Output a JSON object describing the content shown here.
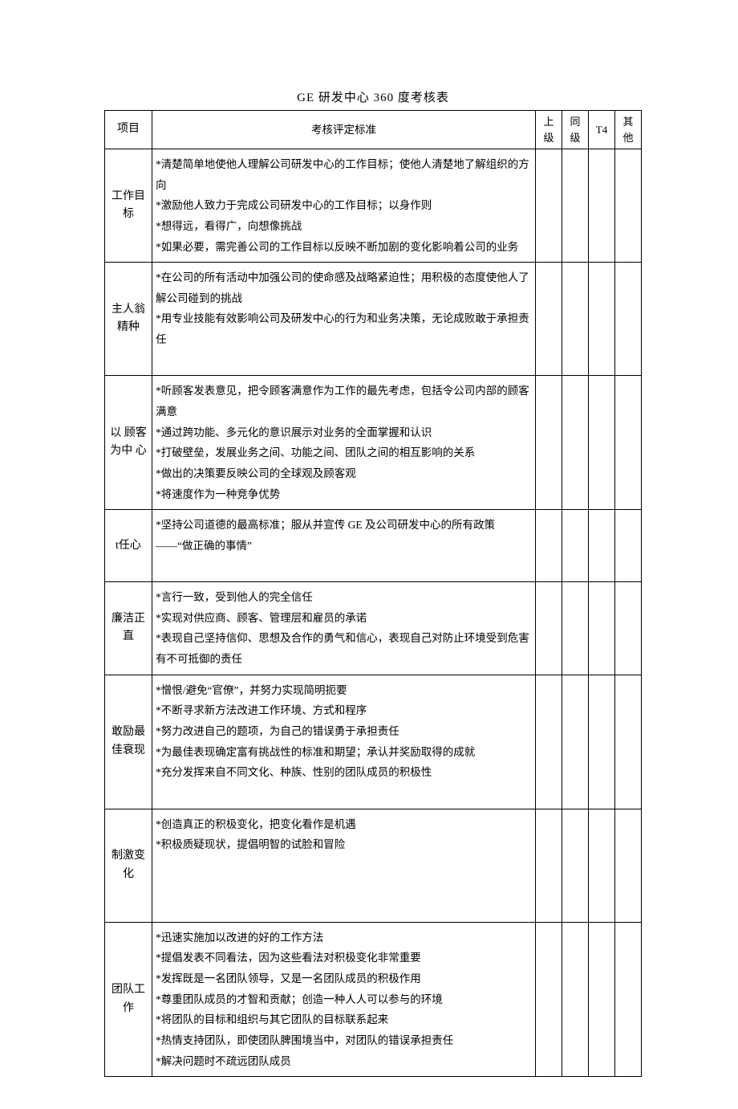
{
  "title": "GE 研发中心 360 度考核表",
  "headers": {
    "category": "项目",
    "standard": "考核评定标准",
    "col1": "上级",
    "col2": "同级",
    "col3": "T4",
    "col4": "其他"
  },
  "rows": [
    {
      "category": "工作目标",
      "lines": [
        "*清楚简单地使他人理解公司研发中心的工作目标；使他人清楚地了解组织的方向",
        "*激励他人致力于完成公司研发中心的工作目标；以身作则",
        "*想得远，看得广，向想像挑战",
        "*如果必要，需完善公司的工作目标以反映不断加剧的变化影响着公司的业务"
      ]
    },
    {
      "category": "主人翁 精种",
      "lines": [
        "*在公司的所有活动中加强公司的使命感及战略紧迫性；用积极的态度使他人了解公司碰到的挑战",
        "*用专业技能有效影响公司及研发中心的行为和业务决策，无论成败敢于承担责任"
      ],
      "padBottom": true
    },
    {
      "category": "以 顾客 为中 心",
      "lines": [
        "*听顾客发表意见，把令顾客满意作为工作的最先考虑，包括令公司内部的顾客满意",
        "*通过跨功能、多元化的意识展示对业务的全面掌握和认识",
        "*打破壁垒，发展业务之间、功能之间、团队之间的相互影响的关系",
        "*做出的决策要反映公司的全球观及顾客观",
        "*将速度作为一种竞争优势"
      ]
    },
    {
      "category": "t任心",
      "lines": [
        "*坚持公司道德的最高标准；服从并宣传 GE 及公司研发中心的所有政策——“做正确的事情”"
      ],
      "padBottom": true
    },
    {
      "category": "廉洁正直",
      "lines": [
        "*言行一致，受到他人的完全信任",
        "*实现对供应商、顾客、管理层和雇员的承诺",
        "*表现自己坚持信仰、思想及合作的勇气和信心，表现自己对防止环境受到危害有不可抵御的责任"
      ]
    },
    {
      "category": "敢励最佳衰现",
      "lines": [
        "*憎恨/避免“官僚”，并努力实现简明扼要",
        "*不断寻求新方法改进工作环境、方式和程序",
        "*努力改进自己的题项，为自己的错误勇于承担责任",
        "*为最佳表现确定富有挑战性的标准和期望；承认并奖励取得的成就",
        "*充分发挥来自不同文化、种族、性别的团队成员的积极性"
      ],
      "padBottom": true
    },
    {
      "category": "制激变化",
      "lines": [
        "*创造真正的积极变化，把变化看作是机遇",
        "*积极质疑现状，提倡明智的试脸和冒险"
      ],
      "padBottomBig": true
    },
    {
      "category": "团队工作",
      "lines": [
        "*迅速实施加以改进的好的工作方法",
        "*提倡发表不同看法，因为这些看法对积极变化非常重要",
        "*发挥既是一名团队领导，又是一名团队成员的积极作用",
        "*尊重团队成员的才智和贡献；创造一种人人可以参与的环境",
        "*将团队的目标和组织与其它团队的目标联系起来",
        "*热情支持团队，即使团队脾围境当中，对团队的错误承担责任",
        "*解决问题时不疏远团队成员"
      ]
    }
  ]
}
